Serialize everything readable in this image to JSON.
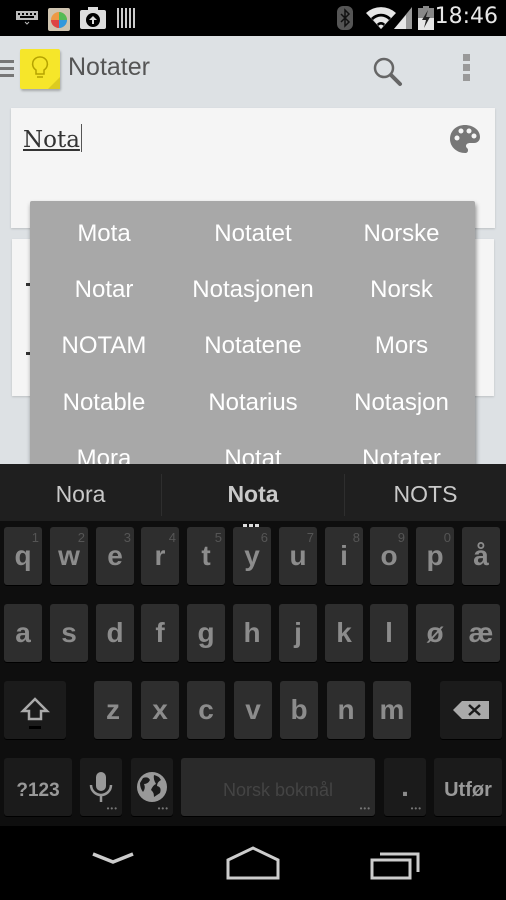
{
  "status_bar": {
    "notification_icons": [
      "keyboard-icon",
      "photos-app-icon",
      "upload-icon",
      "barcode-icon"
    ],
    "system_icons": [
      "bluetooth-icon",
      "wifi-icon",
      "signal-icon",
      "battery-charging-icon"
    ],
    "time": "18:46"
  },
  "action_bar": {
    "nav_icon": "hamburger-icon",
    "app_icon": "keep-lightbulb-icon",
    "title": "Notater",
    "actions": [
      "search-icon",
      "overflow-menu-icon"
    ]
  },
  "note": {
    "title_value": "Nota",
    "color_icon": "palette-icon"
  },
  "autocomplete_popup": {
    "words": [
      "Mota",
      "Notatet",
      "Norske",
      "Notar",
      "Notasjonen",
      "Norsk",
      "NOTAM",
      "Notatene",
      "Mors",
      "Notable",
      "Notarius",
      "Notasjon",
      "Mora",
      "Notat",
      "Notater"
    ]
  },
  "keyboard": {
    "suggestions": [
      "Nora",
      "Nota",
      "NOTS"
    ],
    "row1": [
      {
        "key": "q",
        "hint": "1"
      },
      {
        "key": "w",
        "hint": "2"
      },
      {
        "key": "e",
        "hint": "3"
      },
      {
        "key": "r",
        "hint": "4"
      },
      {
        "key": "t",
        "hint": "5"
      },
      {
        "key": "y",
        "hint": "6"
      },
      {
        "key": "u",
        "hint": "7"
      },
      {
        "key": "i",
        "hint": "8"
      },
      {
        "key": "o",
        "hint": "9"
      },
      {
        "key": "p",
        "hint": "0"
      },
      {
        "key": "å",
        "hint": ""
      }
    ],
    "row2": [
      "a",
      "s",
      "d",
      "f",
      "g",
      "h",
      "j",
      "k",
      "l",
      "ø",
      "æ"
    ],
    "row3": [
      "z",
      "x",
      "c",
      "v",
      "b",
      "n",
      "m"
    ],
    "symbols_label": "?123",
    "space_label": "Norsk bokmål",
    "period_label": ".",
    "action_label": "Utfør"
  },
  "nav_bar": {
    "buttons": [
      "back-icon",
      "home-icon",
      "recent-apps-icon"
    ]
  }
}
